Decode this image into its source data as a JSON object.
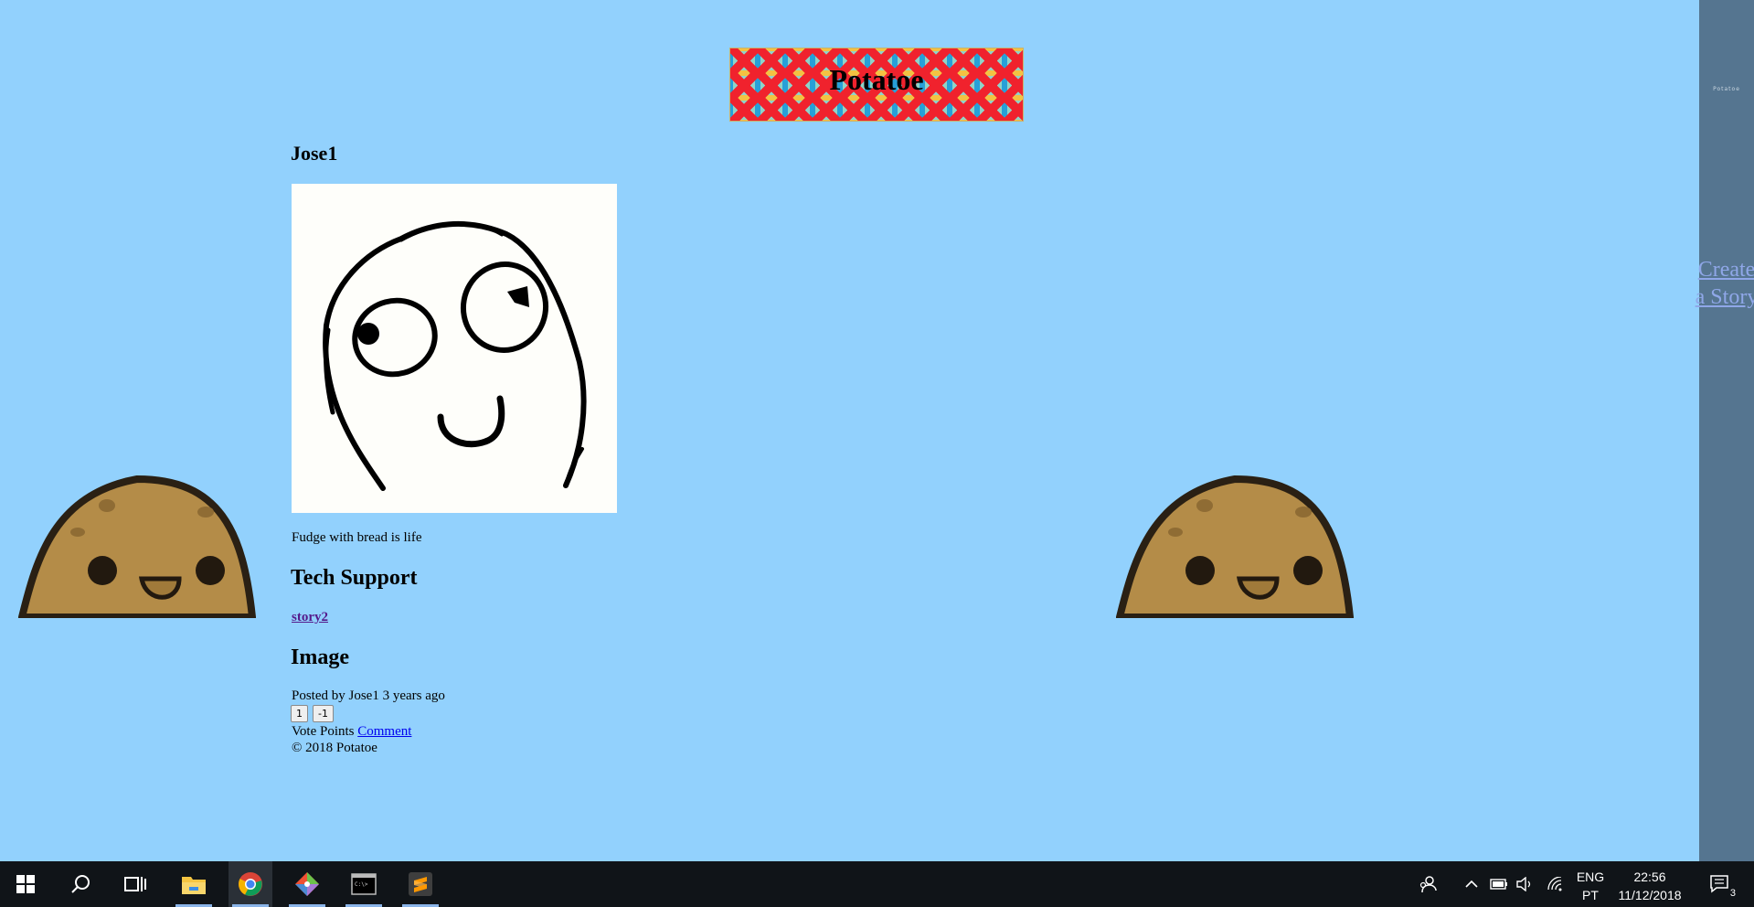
{
  "site": {
    "title": "Potatoe"
  },
  "sidebar": {
    "logo_text": "Potatoe",
    "create_story": "Create a Story"
  },
  "profile": {
    "username": "Jose1",
    "bio": "Fudge with bread is life"
  },
  "story": {
    "title": "Tech Support",
    "link": "story2"
  },
  "post": {
    "title": "Image",
    "posted_by": "Posted by Jose1 3 years ago",
    "upvote_label": "1",
    "downvote_label": "-1",
    "vote_points_label": "Vote Points",
    "comment_link": "Comment"
  },
  "footer": {
    "copyright": "© 2018 Potatoe"
  },
  "taskbar": {
    "apps": [
      "windows-start",
      "search",
      "task-view",
      "file-explorer",
      "chrome",
      "git",
      "terminal",
      "sublime-text"
    ],
    "active_app": "chrome",
    "language_line1": "ENG",
    "language_line2": "PT",
    "time": "22:56",
    "date": "11/12/2018",
    "notification_count": "3"
  },
  "colors": {
    "background": "#92d1fd",
    "sidebar": "#557590",
    "taskbar": "#101418",
    "potato": "#b48c48"
  }
}
